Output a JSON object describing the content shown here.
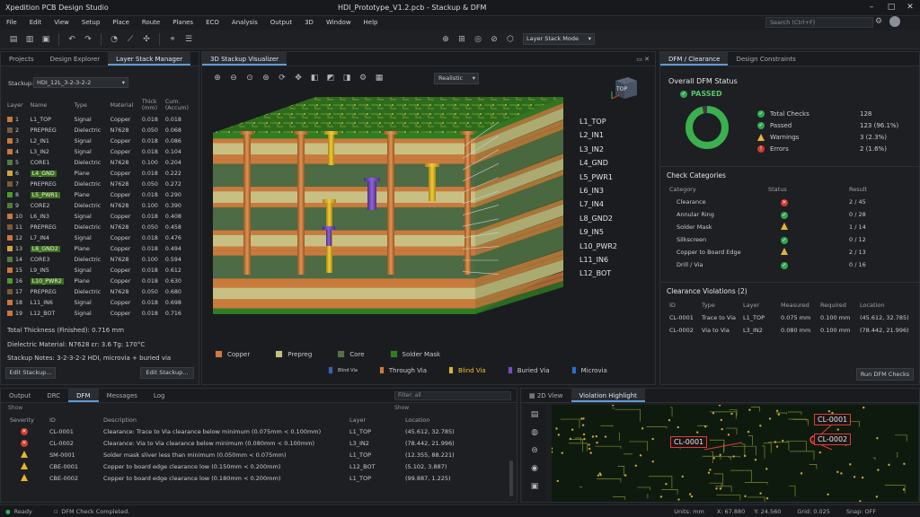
{
  "app": {
    "title": "Xpedition PCB Design Studio",
    "doc_title": "HDI_Prototype_V1.2.pcb - Stackup & DFM"
  },
  "menu": [
    "File",
    "Edit",
    "View",
    "Setup",
    "Place",
    "Route",
    "Planes",
    "ECO",
    "Analysis",
    "Output",
    "3D",
    "Window",
    "Help"
  ],
  "search": {
    "placeholder": "Search (Ctrl+F)"
  },
  "toolbar": {
    "mode": "Layer Stack Mode"
  },
  "left_panel": {
    "tabs": [
      "Projects",
      "Design Explorer",
      "Layer Stack Manager"
    ],
    "stackup_label": "Stackup:",
    "stackup_value": "HDI_12L_3-2-3-2-2",
    "columns": [
      "Layer",
      "Name",
      "Type",
      "Material",
      "Thick (mm)",
      "Cum. (Accum)"
    ],
    "layers": [
      {
        "n": "1",
        "name": "L1_TOP",
        "type": "Signal",
        "mat": "Copper",
        "th": "0.018",
        "cum": "0.018",
        "color": "#c9773b",
        "hl": false
      },
      {
        "n": "2",
        "name": "PREPREG",
        "type": "Dielectric",
        "mat": "N7628",
        "th": "0.050",
        "cum": "0.068",
        "color": "#7c5a38",
        "hl": false
      },
      {
        "n": "3",
        "name": "L2_IN1",
        "type": "Signal",
        "mat": "Copper",
        "th": "0.018",
        "cum": "0.086",
        "color": "#c9773b",
        "hl": false
      },
      {
        "n": "4",
        "name": "L3_IN2",
        "type": "Signal",
        "mat": "Copper",
        "th": "0.018",
        "cum": "0.104",
        "color": "#c9773b",
        "hl": false
      },
      {
        "n": "5",
        "name": "CORE1",
        "type": "Dielectric",
        "mat": "N7628",
        "th": "0.100",
        "cum": "0.204",
        "color": "#557a3a",
        "hl": false
      },
      {
        "n": "6",
        "name": "L4_GND",
        "type": "Plane",
        "mat": "Copper",
        "th": "0.018",
        "cum": "0.222",
        "color": "#d4a340",
        "hl": true
      },
      {
        "n": "7",
        "name": "PREPREG",
        "type": "Dielectric",
        "mat": "N7628",
        "th": "0.050",
        "cum": "0.272",
        "color": "#7c5a38",
        "hl": false
      },
      {
        "n": "8",
        "name": "L5_PWR1",
        "type": "Plane",
        "mat": "Copper",
        "th": "0.018",
        "cum": "0.290",
        "color": "#4f9a2a",
        "hl": true
      },
      {
        "n": "9",
        "name": "CORE2",
        "type": "Dielectric",
        "mat": "N7628",
        "th": "0.100",
        "cum": "0.390",
        "color": "#557a3a",
        "hl": false
      },
      {
        "n": "10",
        "name": "L6_IN3",
        "type": "Signal",
        "mat": "Copper",
        "th": "0.018",
        "cum": "0.408",
        "color": "#c9773b",
        "hl": false
      },
      {
        "n": "11",
        "name": "PREPREG",
        "type": "Dielectric",
        "mat": "N7628",
        "th": "0.050",
        "cum": "0.458",
        "color": "#7c5a38",
        "hl": false
      },
      {
        "n": "12",
        "name": "L7_IN4",
        "type": "Signal",
        "mat": "Copper",
        "th": "0.018",
        "cum": "0.476",
        "color": "#c9773b",
        "hl": false
      },
      {
        "n": "13",
        "name": "L8_GND2",
        "type": "Plane",
        "mat": "Copper",
        "th": "0.018",
        "cum": "0.494",
        "color": "#d4a340",
        "hl": true
      },
      {
        "n": "14",
        "name": "CORE3",
        "type": "Dielectric",
        "mat": "N7628",
        "th": "0.100",
        "cum": "0.594",
        "color": "#557a3a",
        "hl": false
      },
      {
        "n": "15",
        "name": "L9_IN5",
        "type": "Signal",
        "mat": "Copper",
        "th": "0.018",
        "cum": "0.612",
        "color": "#c9773b",
        "hl": false
      },
      {
        "n": "16",
        "name": "L10_PWR2",
        "type": "Plane",
        "mat": "Copper",
        "th": "0.018",
        "cum": "0.630",
        "color": "#4f9a2a",
        "hl": true
      },
      {
        "n": "17",
        "name": "PREPREG",
        "type": "Dielectric",
        "mat": "N7628",
        "th": "0.050",
        "cum": "0.680",
        "color": "#7c5a38",
        "hl": false
      },
      {
        "n": "18",
        "name": "L11_IN6",
        "type": "Signal",
        "mat": "Copper",
        "th": "0.018",
        "cum": "0.698",
        "color": "#c9773b",
        "hl": false
      },
      {
        "n": "19",
        "name": "L12_BOT",
        "type": "Signal",
        "mat": "Copper",
        "th": "0.018",
        "cum": "0.716",
        "color": "#c9773b",
        "hl": false
      }
    ],
    "total": "Total Thickness (Finished): 0.716 mm",
    "dielectric": "Dielectric Material: N7628   εr: 3.6   Tg: 170°C",
    "notes": "Stackup Notes: 3-2-3-2-2 HDI, microvia + buried via",
    "edit_btn": "Edit Stackup...",
    "edit_btn2": "Edit Stackup..."
  },
  "center": {
    "tab": "3D Stackup Visualizer",
    "render_mode": "Realistic",
    "cube_label": "TOP",
    "callouts": [
      "L1_TOP",
      "L2_IN1",
      "L3_IN2",
      "L4_GND",
      "L5_PWR1",
      "L6_IN3",
      "L7_IN4",
      "L8_GND2",
      "L9_IN5",
      "L10_PWR2",
      "L11_IN6",
      "L12_BOT"
    ],
    "legend_top": [
      {
        "label": "Copper",
        "color": "#d07a3c"
      },
      {
        "label": "Prepreg",
        "color": "#c8bf83"
      },
      {
        "label": "Core",
        "color": "#55704a"
      },
      {
        "label": "Solder Mask",
        "color": "#2e7d22"
      }
    ],
    "legend_bottom": [
      {
        "label": "Blind Via",
        "color": "#3c5fb8",
        "dim": true
      },
      {
        "label": "Through Via",
        "color": "#d07a3c"
      },
      {
        "label": "Blind Via",
        "color": "#e1b124",
        "yellow": true
      },
      {
        "label": "Buried Via",
        "color": "#7a4cc2"
      },
      {
        "label": "Microvia",
        "color": "#2b6fd1"
      }
    ]
  },
  "right_panel": {
    "tabs": [
      "DFM / Clearance",
      "Design Constraints"
    ],
    "status_title": "Overall DFM Status",
    "status_value": "PASSED",
    "stats": [
      {
        "label": "Total Checks",
        "value": "128",
        "kind": "g"
      },
      {
        "label": "Passed",
        "value": "123 (96.1%)",
        "kind": "g"
      },
      {
        "label": "Warnings",
        "value": "3 (2.3%)",
        "kind": "w"
      },
      {
        "label": "Errors",
        "value": "2 (1.6%)",
        "kind": "r"
      }
    ],
    "passed_fraction": 0.961,
    "categories_title": "Check Categories",
    "cat_columns": [
      "Category",
      "Status",
      "Result"
    ],
    "categories": [
      {
        "name": "Clearance",
        "status": "r",
        "result": "2 / 45"
      },
      {
        "name": "Annular Ring",
        "status": "g",
        "result": "0 / 28"
      },
      {
        "name": "Solder Mask",
        "status": "w",
        "result": "1 / 14"
      },
      {
        "name": "Silkscreen",
        "status": "g",
        "result": "0 / 12"
      },
      {
        "name": "Copper to Board Edge",
        "status": "w",
        "result": "2 / 13"
      },
      {
        "name": "Drill / Via",
        "status": "g",
        "result": "0 / 16"
      }
    ],
    "violations_title": "Clearance Violations (2)",
    "viol_columns": [
      "ID",
      "Type",
      "Layer",
      "Measured",
      "Required",
      "Location"
    ],
    "violations": [
      {
        "id": "CL-0001",
        "type": "Trace to Via",
        "layer": "L1_TOP",
        "meas": "0.075 mm",
        "req": "0.100 mm",
        "loc": "(45.612, 32.785)"
      },
      {
        "id": "CL-0002",
        "type": "Via to Via",
        "layer": "L3_IN2",
        "meas": "0.080 mm",
        "req": "0.100 mm",
        "loc": "(78.442, 21.996)"
      }
    ],
    "run_btn": "Run DFM Checks"
  },
  "bottom": {
    "tabs": [
      "Output",
      "DRC",
      "DFM",
      "Messages",
      "Log"
    ],
    "filter_placeholder": "Filter: all",
    "filter_sub": "Show",
    "columns": [
      "Severity",
      "ID",
      "Description",
      "Layer",
      "Location"
    ],
    "rows": [
      {
        "sev": "r",
        "id": "CL-0001",
        "desc": "Clearance: Trace to Via clearance below minimum (0.075mm < 0.100mm)",
        "layer": "L1_TOP",
        "loc": "(45.612, 32.785)"
      },
      {
        "sev": "r",
        "id": "CL-0002",
        "desc": "Clearance: Via to Via clearance below minimum (0.080mm < 0.100mm)",
        "layer": "L3_IN2",
        "loc": "(78.442, 21.996)"
      },
      {
        "sev": "w",
        "id": "SM-0001",
        "desc": "Solder mask sliver less than minimum (0.050mm < 0.075mm)",
        "layer": "L1_TOP",
        "loc": "(12.355, 88.221)"
      },
      {
        "sev": "w",
        "id": "CBE-0001",
        "desc": "Copper to board edge clearance low (0.150mm < 0.200mm)",
        "layer": "L12_BOT",
        "loc": "(5.102, 3.887)"
      },
      {
        "sev": "w",
        "id": "CBE-0002",
        "desc": "Copper to board edge clearance low (0.180mm < 0.200mm)",
        "layer": "L1_TOP",
        "loc": "(99.887, 1.225)"
      }
    ],
    "view_tabs": [
      "2D View",
      "Violation Highlight"
    ],
    "markers": [
      "CL-0001",
      "CL-0002",
      "CL-0001"
    ]
  },
  "status": {
    "ready": "Ready",
    "msg": "DFM Check Completed.",
    "units": "Units: mm",
    "x": "X: 67.880",
    "y": "Y: 24.560",
    "grid": "Grid: 0.025",
    "snap": "Snap: OFF"
  }
}
